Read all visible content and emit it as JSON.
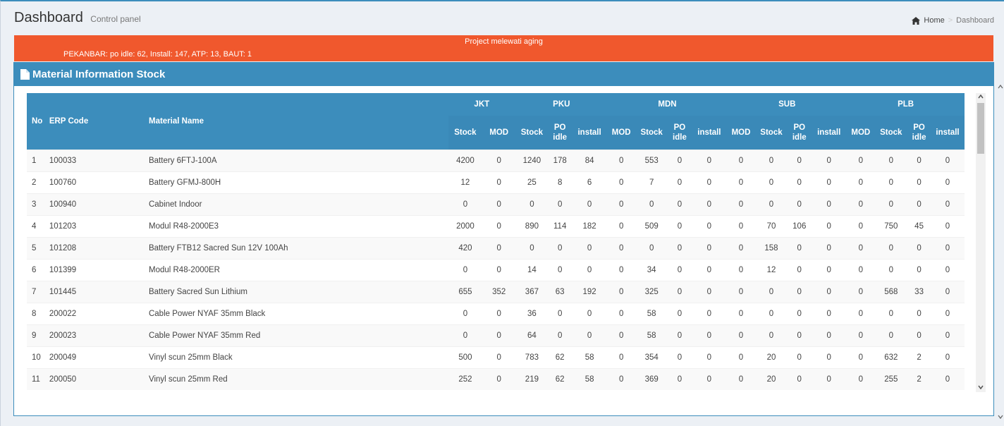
{
  "header": {
    "title": "Dashboard",
    "subtitle": "Control panel",
    "breadcrumb": {
      "home": "Home",
      "separator": ">",
      "current": "Dashboard"
    }
  },
  "alert": {
    "title": "Project melewati aging",
    "message": "PEKANBAR: po idle: 62, Install: 147, ATP: 13, BAUT: 1",
    "color": "#f0582d"
  },
  "box": {
    "title": "Material Information Stock",
    "color": "#3c8dbc"
  },
  "table": {
    "headers": {
      "no": "No",
      "erp": "ERP Code",
      "name": "Material Name"
    },
    "regions": [
      "JKT",
      "PKU",
      "MDN",
      "SUB",
      "PLB"
    ],
    "subheaders": {
      "stock": "Stock",
      "mod": "MOD",
      "po_line1": "PO",
      "po_line2": "idle",
      "install": "install"
    },
    "rows": [
      {
        "no": "1",
        "erp": "100033",
        "name": "Battery 6FTJ-100A",
        "vals": [
          "4200",
          "0",
          "1240",
          "178",
          "84",
          "0",
          "553",
          "0",
          "0",
          "0",
          "0",
          "0",
          "0",
          "0",
          "0",
          "0",
          "0"
        ]
      },
      {
        "no": "2",
        "erp": "100760",
        "name": "Battery GFMJ-800H",
        "vals": [
          "12",
          "0",
          "25",
          "8",
          "6",
          "0",
          "7",
          "0",
          "0",
          "0",
          "0",
          "0",
          "0",
          "0",
          "0",
          "0",
          "0"
        ]
      },
      {
        "no": "3",
        "erp": "100940",
        "name": "Cabinet Indoor",
        "vals": [
          "0",
          "0",
          "0",
          "0",
          "0",
          "0",
          "0",
          "0",
          "0",
          "0",
          "0",
          "0",
          "0",
          "0",
          "0",
          "0",
          "0"
        ]
      },
      {
        "no": "4",
        "erp": "101203",
        "name": "Modul R48-2000E3",
        "vals": [
          "2000",
          "0",
          "890",
          "114",
          "182",
          "0",
          "509",
          "0",
          "0",
          "0",
          "70",
          "106",
          "0",
          "0",
          "750",
          "45",
          "0"
        ]
      },
      {
        "no": "5",
        "erp": "101208",
        "name": "Battery FTB12 Sacred Sun 12V 100Ah",
        "vals": [
          "420",
          "0",
          "0",
          "0",
          "0",
          "0",
          "0",
          "0",
          "0",
          "0",
          "158",
          "0",
          "0",
          "0",
          "0",
          "0",
          "0"
        ]
      },
      {
        "no": "6",
        "erp": "101399",
        "name": "Modul R48-2000ER",
        "vals": [
          "0",
          "0",
          "14",
          "0",
          "0",
          "0",
          "34",
          "0",
          "0",
          "0",
          "12",
          "0",
          "0",
          "0",
          "0",
          "0",
          "0"
        ]
      },
      {
        "no": "7",
        "erp": "101445",
        "name": "Battery Sacred Sun Lithium",
        "vals": [
          "655",
          "352",
          "367",
          "63",
          "192",
          "0",
          "325",
          "0",
          "0",
          "0",
          "0",
          "0",
          "0",
          "0",
          "568",
          "33",
          "0"
        ]
      },
      {
        "no": "8",
        "erp": "200022",
        "name": "Cable Power NYAF 35mm Black",
        "vals": [
          "0",
          "0",
          "36",
          "0",
          "0",
          "0",
          "58",
          "0",
          "0",
          "0",
          "0",
          "0",
          "0",
          "0",
          "0",
          "0",
          "0"
        ]
      },
      {
        "no": "9",
        "erp": "200023",
        "name": "Cable Power NYAF 35mm Red",
        "vals": [
          "0",
          "0",
          "64",
          "0",
          "0",
          "0",
          "58",
          "0",
          "0",
          "0",
          "0",
          "0",
          "0",
          "0",
          "0",
          "0",
          "0"
        ]
      },
      {
        "no": "10",
        "erp": "200049",
        "name": "Vinyl scun 25mm Black",
        "vals": [
          "500",
          "0",
          "783",
          "62",
          "58",
          "0",
          "354",
          "0",
          "0",
          "0",
          "20",
          "0",
          "0",
          "0",
          "632",
          "2",
          "0"
        ]
      },
      {
        "no": "11",
        "erp": "200050",
        "name": "Vinyl scun 25mm Red",
        "vals": [
          "252",
          "0",
          "219",
          "62",
          "58",
          "0",
          "369",
          "0",
          "0",
          "0",
          "20",
          "0",
          "0",
          "0",
          "255",
          "2",
          "0"
        ]
      }
    ]
  },
  "icons": {
    "home": "home-icon",
    "file": "file-icon",
    "scroll_up": "chevron-up-icon",
    "scroll_down": "chevron-down-icon"
  }
}
